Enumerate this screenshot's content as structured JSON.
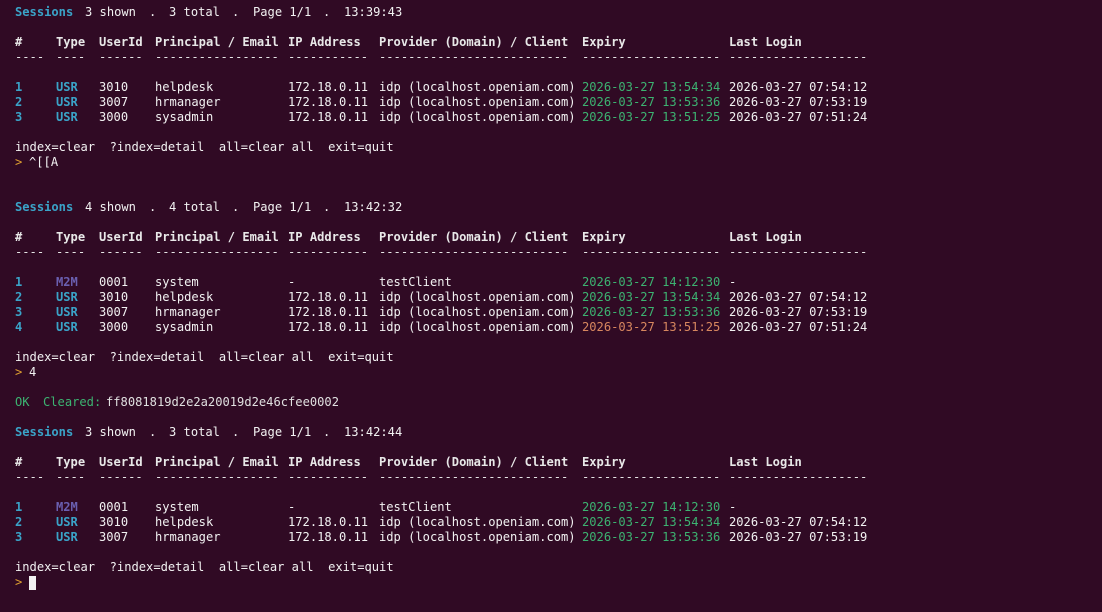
{
  "colors": {
    "background": "#300a24",
    "accent_cyan": "#3aa3c8",
    "expiry_ok": "#3cb371",
    "expiry_warn": "#d7875f",
    "m2m_type": "#6a5fb0",
    "prompt": "#e0a030"
  },
  "headers": {
    "num": "#",
    "type": "Type",
    "userid": "UserId",
    "principal": "Principal / Email",
    "ip": "IP Address",
    "provider": "Provider (Domain) / Client",
    "expiry": "Expiry",
    "last_login": "Last Login"
  },
  "separators": {
    "num": "----",
    "type": "----",
    "userid": "------",
    "principal": "-----------------",
    "ip": "-----------",
    "provider": "--------------------------",
    "expiry": "-------------------",
    "last_login": "-------------------"
  },
  "prompt_symbol": ">",
  "help_line": "index=clear  ?index=detail  all=clear all  exit=quit",
  "blocks": [
    {
      "summary": {
        "label": "Sessions",
        "shown": "3 shown",
        "dot1": ".",
        "total": "3 total",
        "dot2": ".",
        "page": "Page 1/1",
        "dot3": ".",
        "time": "13:39:43"
      },
      "rows": [
        {
          "idx": "1",
          "type": "USR",
          "userid": "3010",
          "principal": "helpdesk",
          "ip": "172.18.0.11",
          "provider": "idp (localhost.openiam.com)",
          "expiry": "2026-03-27 13:54:34",
          "expiry_status": "ok",
          "last_login": "2026-03-27 07:54:12"
        },
        {
          "idx": "2",
          "type": "USR",
          "userid": "3007",
          "principal": "hrmanager",
          "ip": "172.18.0.11",
          "provider": "idp (localhost.openiam.com)",
          "expiry": "2026-03-27 13:53:36",
          "expiry_status": "ok",
          "last_login": "2026-03-27 07:53:19"
        },
        {
          "idx": "3",
          "type": "USR",
          "userid": "3000",
          "principal": "sysadmin",
          "ip": "172.18.0.11",
          "provider": "idp (localhost.openiam.com)",
          "expiry": "2026-03-27 13:51:25",
          "expiry_status": "ok",
          "last_login": "2026-03-27 07:51:24"
        }
      ],
      "input": "^[[A"
    },
    {
      "summary": {
        "label": "Sessions",
        "shown": "4 shown",
        "dot1": ".",
        "total": "4 total",
        "dot2": ".",
        "page": "Page 1/1",
        "dot3": ".",
        "time": "13:42:32"
      },
      "rows": [
        {
          "idx": "1",
          "type": "M2M",
          "userid": "0001",
          "principal": "system",
          "ip": "-",
          "provider": "testClient",
          "expiry": "2026-03-27 14:12:30",
          "expiry_status": "ok",
          "last_login": "-"
        },
        {
          "idx": "2",
          "type": "USR",
          "userid": "3010",
          "principal": "helpdesk",
          "ip": "172.18.0.11",
          "provider": "idp (localhost.openiam.com)",
          "expiry": "2026-03-27 13:54:34",
          "expiry_status": "ok",
          "last_login": "2026-03-27 07:54:12"
        },
        {
          "idx": "3",
          "type": "USR",
          "userid": "3007",
          "principal": "hrmanager",
          "ip": "172.18.0.11",
          "provider": "idp (localhost.openiam.com)",
          "expiry": "2026-03-27 13:53:36",
          "expiry_status": "ok",
          "last_login": "2026-03-27 07:53:19"
        },
        {
          "idx": "4",
          "type": "USR",
          "userid": "3000",
          "principal": "sysadmin",
          "ip": "172.18.0.11",
          "provider": "idp (localhost.openiam.com)",
          "expiry": "2026-03-27 13:51:25",
          "expiry_status": "warn",
          "last_login": "2026-03-27 07:51:24"
        }
      ],
      "input": "4"
    },
    {
      "summary": {
        "label": "Sessions",
        "shown": "3 shown",
        "dot1": ".",
        "total": "3 total",
        "dot2": ".",
        "page": "Page 1/1",
        "dot3": ".",
        "time": "13:42:44"
      },
      "rows": [
        {
          "idx": "1",
          "type": "M2M",
          "userid": "0001",
          "principal": "system",
          "ip": "-",
          "provider": "testClient",
          "expiry": "2026-03-27 14:12:30",
          "expiry_status": "ok",
          "last_login": "-"
        },
        {
          "idx": "2",
          "type": "USR",
          "userid": "3010",
          "principal": "helpdesk",
          "ip": "172.18.0.11",
          "provider": "idp (localhost.openiam.com)",
          "expiry": "2026-03-27 13:54:34",
          "expiry_status": "ok",
          "last_login": "2026-03-27 07:54:12"
        },
        {
          "idx": "3",
          "type": "USR",
          "userid": "3007",
          "principal": "hrmanager",
          "ip": "172.18.0.11",
          "provider": "idp (localhost.openiam.com)",
          "expiry": "2026-03-27 13:53:36",
          "expiry_status": "ok",
          "last_login": "2026-03-27 07:53:19"
        }
      ],
      "input": ""
    }
  ],
  "cleared_message": {
    "status": "OK",
    "label": "Cleared:",
    "id": "ff8081819d2e2a20019d2e46cfee0002"
  }
}
